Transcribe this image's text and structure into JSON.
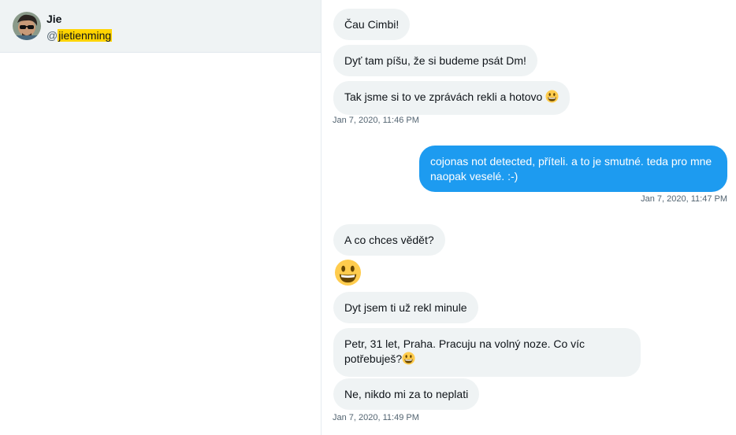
{
  "user": {
    "name": "Jie",
    "handle_prefix": "@",
    "handle": "jietienming"
  },
  "messages": [
    {
      "text": "Čau Cimbi!"
    },
    {
      "text": "Dyť tam píšu, že si budeme psát Dm!"
    },
    {
      "text": "Tak jsme si to ve zprávách rekli a hotovo",
      "emoji": "grinning-emoji"
    },
    {
      "timestamp": "Jan 7, 2020, 11:46 PM"
    },
    {
      "text": "cojonas not detected, příteli. a to je smutné. teda pro mne naopak veselé. :-)"
    },
    {
      "timestamp": "Jan 7, 2020, 11:47 PM"
    },
    {
      "text": "A co chces vědět?"
    },
    {
      "emoji": "grinning-emoji-large"
    },
    {
      "text": "Dyt jsem ti už rekl minule"
    },
    {
      "text": "Petr, 31 let, Praha. Pracuju na volný noze. Co víc potřebuješ?",
      "emoji": "grinning-emoji"
    },
    {
      "text": "Ne, nikdo mi za to neplati"
    },
    {
      "timestamp": "Jan 7, 2020, 11:49 PM"
    }
  ],
  "colors": {
    "incoming_bubble": "#eff3f4",
    "outgoing_bubble": "#1d9bf0",
    "handle_highlight": "#ffd400"
  }
}
